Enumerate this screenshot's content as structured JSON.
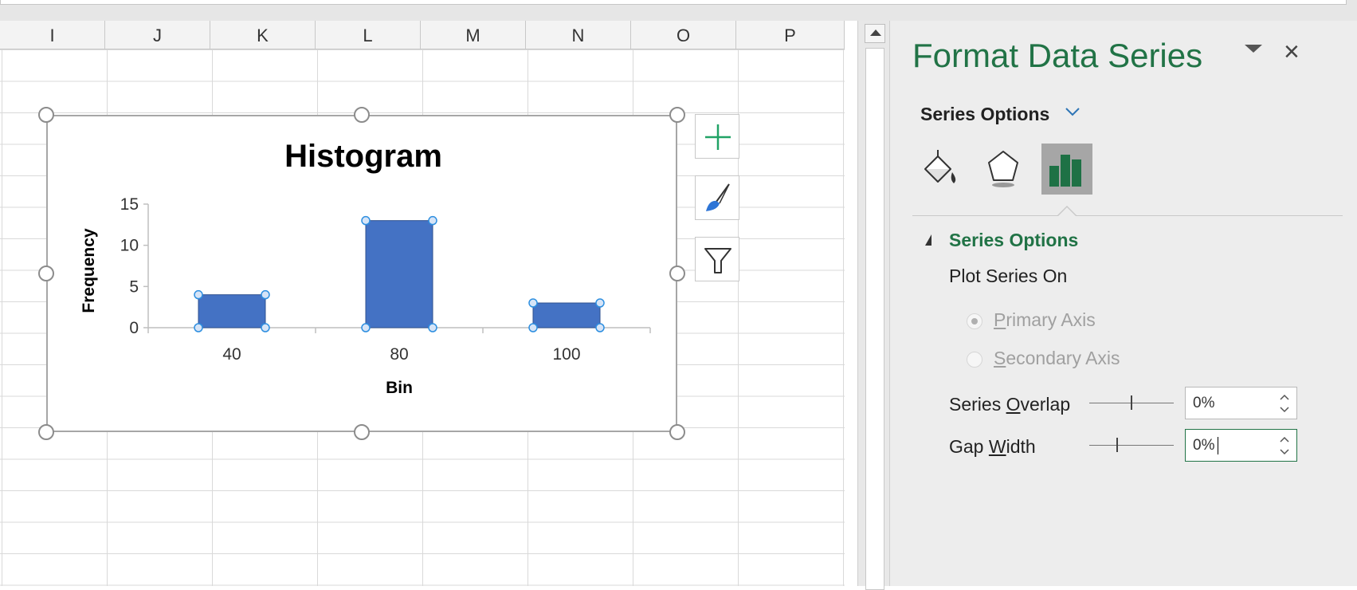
{
  "sheet": {
    "columns": [
      "I",
      "J",
      "K",
      "L",
      "M",
      "N",
      "O",
      "P"
    ]
  },
  "chart": {
    "title": "Histogram",
    "y_axis_title": "Frequency",
    "x_axis_title": "Bin"
  },
  "chart_data": {
    "type": "bar",
    "title": "Histogram",
    "xlabel": "Bin",
    "ylabel": "Frequency",
    "categories": [
      "40",
      "80",
      "100"
    ],
    "values": [
      4,
      13,
      3
    ],
    "ylim": [
      0,
      15
    ],
    "yticks": [
      "0",
      "5",
      "10",
      "15"
    ],
    "color": "#4472c4",
    "grid": false,
    "legend": "none"
  },
  "chart_buttons": {
    "elements": "plus-icon",
    "styles": "brush-icon",
    "filters": "funnel-icon"
  },
  "pane": {
    "title": "Format Data Series",
    "close_label": "×",
    "dropdown_label": "Series Options",
    "section_title": "Series Options",
    "plot_series_on": "Plot Series On",
    "primary_axis": {
      "prefix": "",
      "ul": "P",
      "rest": "rimary Axis"
    },
    "secondary_axis": {
      "prefix": "",
      "ul": "S",
      "rest": "econdary Axis"
    },
    "series_overlap": {
      "prefix": "Series ",
      "ul": "O",
      "rest": "verlap",
      "value": "0%"
    },
    "gap_width": {
      "prefix": "Gap ",
      "ul": "W",
      "rest": "idth",
      "value": "0%"
    },
    "accent_color": "#217346"
  }
}
